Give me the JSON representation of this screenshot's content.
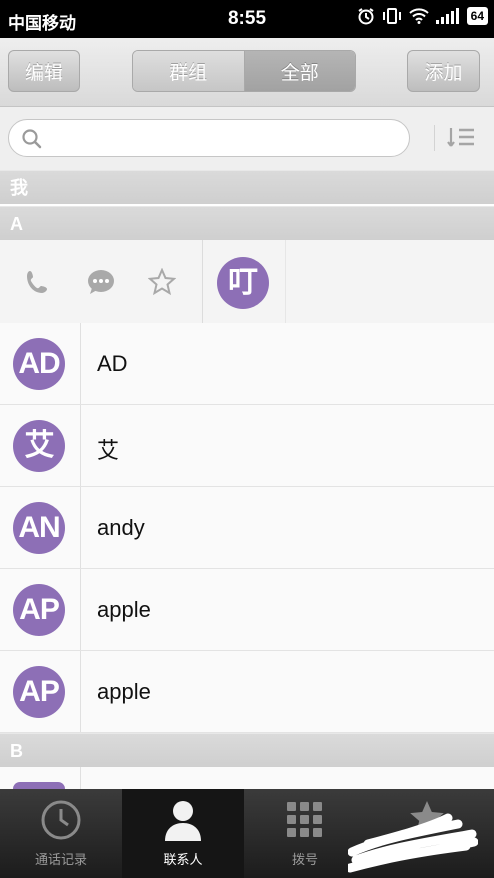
{
  "status": {
    "carrier": "中国移动",
    "time": "8:55",
    "battery": "64"
  },
  "header": {
    "edit_label": "编辑",
    "add_label": "添加",
    "segments": [
      "群组",
      "全部"
    ],
    "active_segment": "全部"
  },
  "search": {
    "placeholder": ""
  },
  "sections": {
    "me": "我",
    "a": "A",
    "b": "B"
  },
  "contacts": [
    {
      "name": "AD",
      "avatar_text": "AD"
    },
    {
      "name": "艾",
      "avatar_text": "艾"
    },
    {
      "name": "andy",
      "avatar_text": "AN"
    },
    {
      "name": "apple",
      "avatar_text": "AP"
    },
    {
      "name": "apple",
      "avatar_text": "AP"
    }
  ],
  "action_row": {
    "avatar_text": "叮"
  },
  "tabs": [
    {
      "label": "通话记录",
      "icon": "clock-icon"
    },
    {
      "label": "联系人",
      "icon": "person-icon",
      "active": true
    },
    {
      "label": "拨号",
      "icon": "keypad-icon"
    },
    {
      "label": "",
      "icon": "star-icon"
    }
  ],
  "colors": {
    "avatar": "#8d6fb6",
    "statusbar": "#000000",
    "tabbar": "#1f1f1f"
  }
}
